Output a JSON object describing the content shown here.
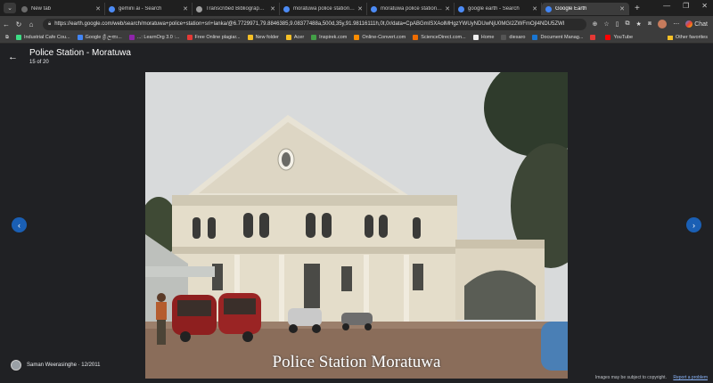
{
  "browser": {
    "tabs": [
      {
        "label": "New tab",
        "color": "#6b6b6b",
        "active": false
      },
      {
        "label": "gemini ai - Search",
        "color": "#4c8bf5",
        "active": false
      },
      {
        "label": "Transcribed Bibliography Text",
        "color": "#9e9e9e",
        "active": false
      },
      {
        "label": "moratuwa police station - Search",
        "color": "#4c8bf5",
        "active": false
      },
      {
        "label": "moratuwa police station sri lanka",
        "color": "#4c8bf5",
        "active": false
      },
      {
        "label": "google earth - Search",
        "color": "#4c8bf5",
        "active": false
      },
      {
        "label": "Google Earth",
        "color": "#4285f4",
        "active": true
      }
    ],
    "url": "https://earth.google.com/web/search/moratuwa+police+station+sri+lanka/@6.7729971,79.8846385,9.08377488a,500d,35y,91.98116111h,0t,0r/data=CpABGmISXAolMHgzYWUyNDUwNjU0MGI2ZWFmOjI4NDU5ZWI",
    "chat_label": "Chat",
    "bookmarks": [
      {
        "label": "Industrial Cafe Cou...",
        "color": "#3ddc84"
      },
      {
        "label": "Google ශ්‍රී ලංකා...",
        "color": "#4285f4"
      },
      {
        "label": "...: LearnOrg 3.0 :...",
        "color": "#8e24aa"
      },
      {
        "label": "Free Online plagiar...",
        "color": "#e53935"
      },
      {
        "label": "New folder",
        "color": "#f6c026"
      },
      {
        "label": "Acer",
        "color": "#f6c026"
      },
      {
        "label": "Inspirek.com",
        "color": "#43a047"
      },
      {
        "label": "Online-Convert.com",
        "color": "#fb8c00"
      },
      {
        "label": "ScienceDirect.com...",
        "color": "#ef6c00"
      },
      {
        "label": "Home",
        "color": "#eeeeee"
      },
      {
        "label": "diesaro",
        "color": "#555555"
      },
      {
        "label": "Document Manag...",
        "color": "#1976d2"
      },
      {
        "label": "",
        "color": "#e53935"
      },
      {
        "label": "YouTube",
        "color": "#ff0000"
      }
    ],
    "other_favorites": "Other favorites"
  },
  "viewer": {
    "title": "Police Station - Moratuwa",
    "counter": "15 of 20",
    "caption": "Police Station Moratuwa",
    "credit": "Saman Weerasinghe · 12/2011",
    "copyright": "Images may be subject to copyright.",
    "report": "Report a problem"
  },
  "icons": {
    "back": "arrow-left-icon",
    "prev": "chevron-left-icon",
    "next": "chevron-right-icon"
  }
}
